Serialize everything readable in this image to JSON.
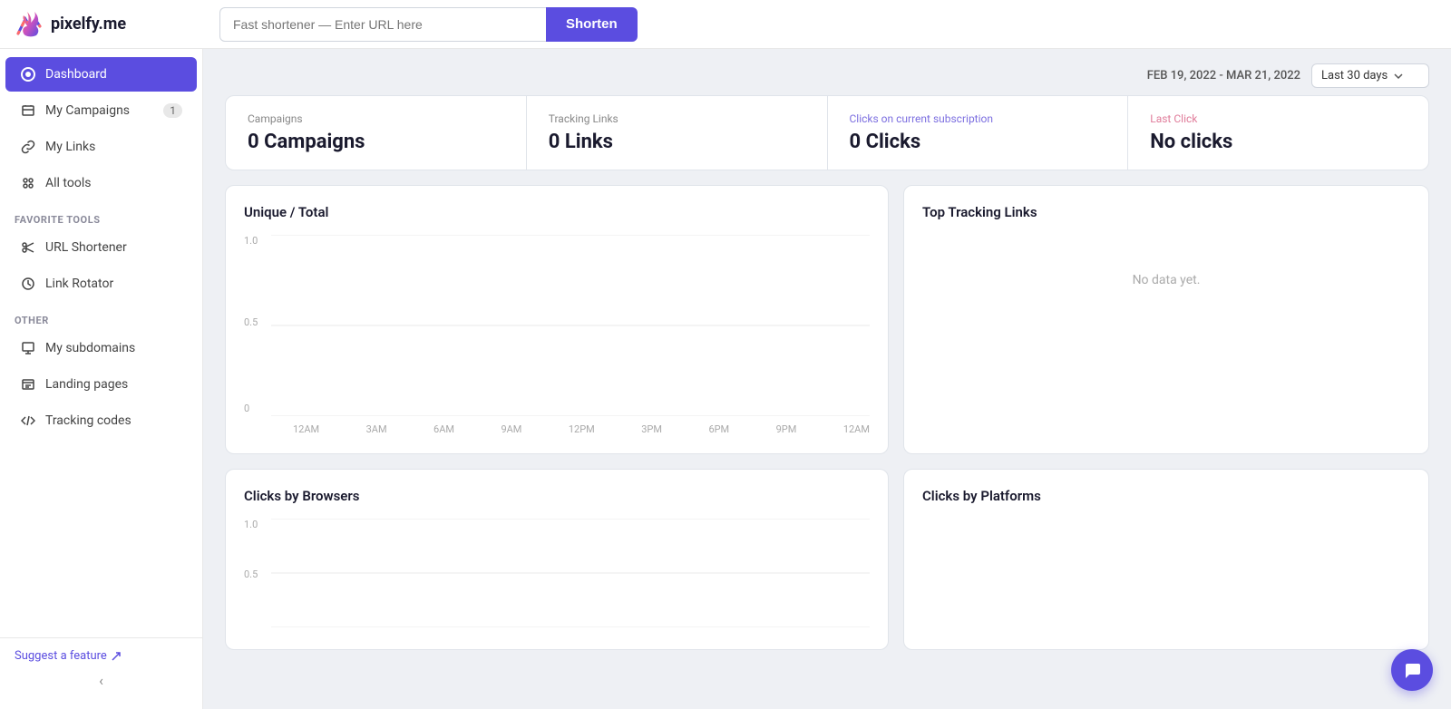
{
  "topbar": {
    "logo_text": "pixelfy.me",
    "url_input_placeholder": "Fast shortener — Enter URL here",
    "shorten_label": "Shorten"
  },
  "sidebar": {
    "nav_items": [
      {
        "id": "dashboard",
        "label": "Dashboard",
        "icon": "dashboard-icon",
        "active": true,
        "badge": null
      },
      {
        "id": "my-campaigns",
        "label": "My Campaigns",
        "icon": "campaigns-icon",
        "active": false,
        "badge": "1"
      },
      {
        "id": "my-links",
        "label": "My Links",
        "icon": "links-icon",
        "active": false,
        "badge": null
      },
      {
        "id": "all-tools",
        "label": "All tools",
        "icon": "tools-icon",
        "active": false,
        "badge": null
      }
    ],
    "favorite_section_label": "FAVORITE TOOLS",
    "favorite_items": [
      {
        "id": "url-shortener",
        "label": "URL Shortener",
        "icon": "scissors-icon"
      },
      {
        "id": "link-rotator",
        "label": "Link Rotator",
        "icon": "rotator-icon"
      }
    ],
    "other_section_label": "OTHER",
    "other_items": [
      {
        "id": "my-subdomains",
        "label": "My subdomains",
        "icon": "subdomains-icon"
      },
      {
        "id": "landing-pages",
        "label": "Landing pages",
        "icon": "landing-icon"
      },
      {
        "id": "tracking-codes",
        "label": "Tracking codes",
        "icon": "code-icon"
      }
    ],
    "suggest_label": "Suggest a feature",
    "collapse_label": "‹"
  },
  "date_bar": {
    "date_range": "FEB 19, 2022 - MAR 21, 2022",
    "period_label": "Last 30 days"
  },
  "stats": [
    {
      "label": "Campaigns",
      "value": "0 Campaigns"
    },
    {
      "label": "Tracking Links",
      "value": "0 Links"
    },
    {
      "label": "Clicks on current subscription",
      "value": "0 Clicks",
      "label_color": "purple"
    },
    {
      "label": "Last Click",
      "value": "No clicks",
      "label_color": "pink"
    }
  ],
  "charts": {
    "unique_total": {
      "title": "Unique / Total",
      "y_labels": [
        "1.0",
        "0.5",
        "0"
      ],
      "x_labels": [
        "12AM",
        "3AM",
        "6AM",
        "9AM",
        "12PM",
        "3PM",
        "6PM",
        "9PM",
        "12AM"
      ]
    },
    "top_tracking_links": {
      "title": "Top Tracking Links",
      "no_data_text": "No data yet."
    },
    "clicks_by_browsers": {
      "title": "Clicks by Browsers",
      "y_labels": [
        "1.0",
        "0.5"
      ]
    },
    "clicks_by_platforms": {
      "title": "Clicks by Platforms"
    }
  }
}
